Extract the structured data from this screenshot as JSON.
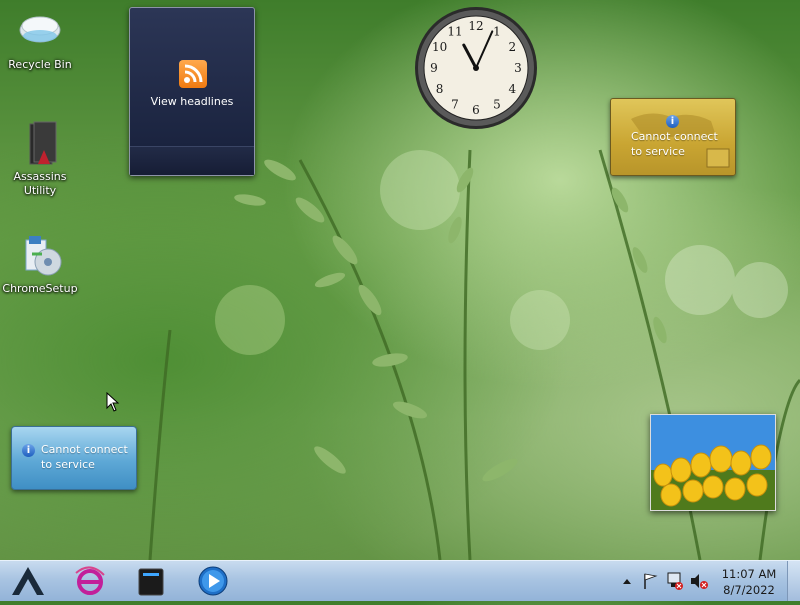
{
  "desktop": {
    "icons": [
      {
        "label": "Recycle Bin",
        "icon": "recycle-bin-icon"
      },
      {
        "label": "Assassins Utility",
        "icon": "assassins-utility-icon"
      },
      {
        "label": "ChromeSetup",
        "icon": "chrome-setup-icon"
      }
    ]
  },
  "gadgets": {
    "rss": {
      "label": "View headlines",
      "icon": "rss-icon"
    },
    "clock": {
      "hour": 11,
      "minute": 4,
      "numbers": [
        "12",
        "1",
        "2",
        "3",
        "4",
        "5",
        "6",
        "7",
        "8",
        "9",
        "10",
        "11"
      ]
    },
    "currency": {
      "message_line1": "Cannot connect",
      "message_line2": "to service",
      "icon": "info-icon"
    },
    "weather": {
      "message_line1": "Cannot connect",
      "message_line2": "to service",
      "icon": "info-icon"
    },
    "slideshow": {
      "image": "yellow-tulips-photo"
    }
  },
  "taskbar": {
    "pinned": [
      "start-logo-icon",
      "internet-explorer-icon",
      "storage-drive-icon",
      "media-player-icon"
    ],
    "tray": [
      "show-hidden-icons-arrow",
      "action-center-flag-icon",
      "network-disconnected-icon",
      "volume-muted-icon"
    ],
    "time": "11:07 AM",
    "date": "8/7/2022"
  },
  "colors": {
    "taskbar": "#a9c4e2",
    "rss_orange": "#f07a10",
    "currency_gold": "#c9a532",
    "weather_blue": "#5ea8d6"
  }
}
